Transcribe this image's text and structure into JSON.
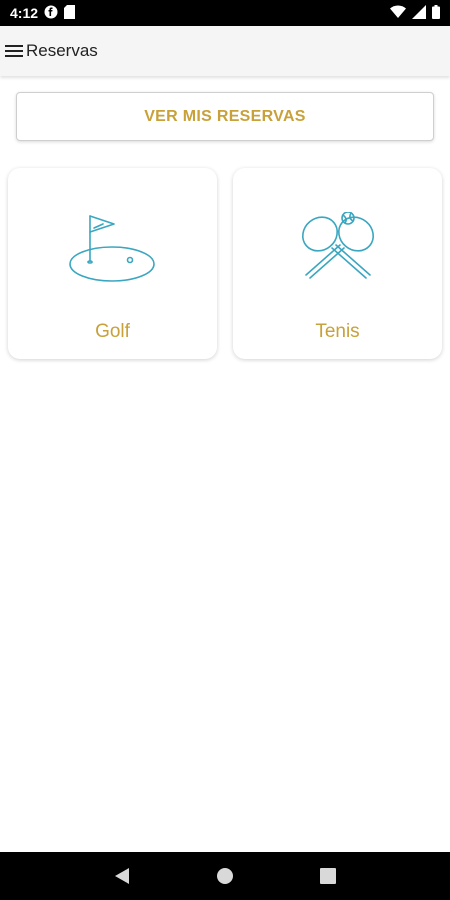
{
  "status_bar": {
    "time": "4:12",
    "icons": [
      "f-notification-icon",
      "sd-card-icon",
      "wifi-icon",
      "signal-icon",
      "battery-icon"
    ]
  },
  "app_bar": {
    "title": "Reservas",
    "menu_icon": "menu-icon"
  },
  "main": {
    "primary_button_label": "VER MIS RESERVAS",
    "cards": [
      {
        "label": "Golf",
        "icon": "golf-flag-icon"
      },
      {
        "label": "Tenis",
        "icon": "tennis-rackets-icon"
      }
    ]
  },
  "nav_bar": {
    "buttons": [
      "back-icon",
      "home-icon",
      "recents-icon"
    ]
  },
  "colors": {
    "accent_gold": "#c8a13a",
    "icon_teal": "#3aa6c0",
    "app_bar_bg": "#f5f5f5"
  }
}
